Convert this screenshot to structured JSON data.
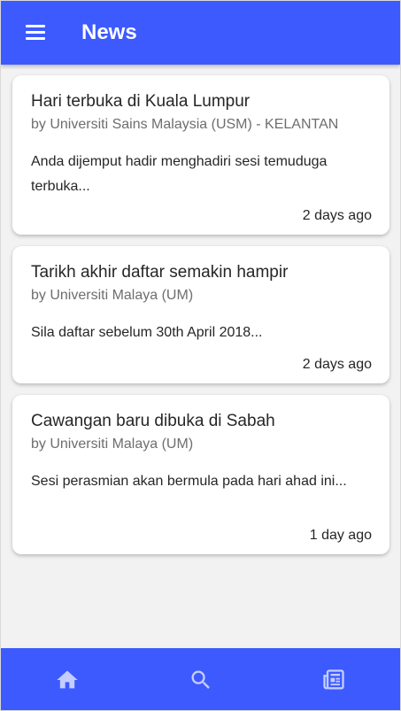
{
  "appbar": {
    "title": "News",
    "menu_icon": "menu-icon"
  },
  "news": [
    {
      "title": "Hari terbuka di Kuala Lumpur",
      "source": "by Universiti Sains Malaysia (USM) - KELANTAN",
      "excerpt": "Anda dijemput hadir menghadiri sesi temuduga terbuka...",
      "time": "2 days ago"
    },
    {
      "title": "Tarikh akhir daftar semakin hampir",
      "source": "by Universiti Malaya (UM)",
      "excerpt": "Sila daftar sebelum 30th April 2018...",
      "time": "2 days ago"
    },
    {
      "title": "Cawangan baru dibuka di Sabah",
      "source": "by Universiti Malaya (UM)",
      "excerpt": "Sesi perasmian akan bermula pada hari ahad ini...",
      "time": "1 day ago"
    }
  ],
  "bottom_nav": {
    "items": [
      "home-icon",
      "search-icon",
      "newspaper-icon"
    ]
  },
  "colors": {
    "primary": "#3d5afe",
    "nav_icon": "#c5cdff",
    "background": "#f2f2f2"
  }
}
